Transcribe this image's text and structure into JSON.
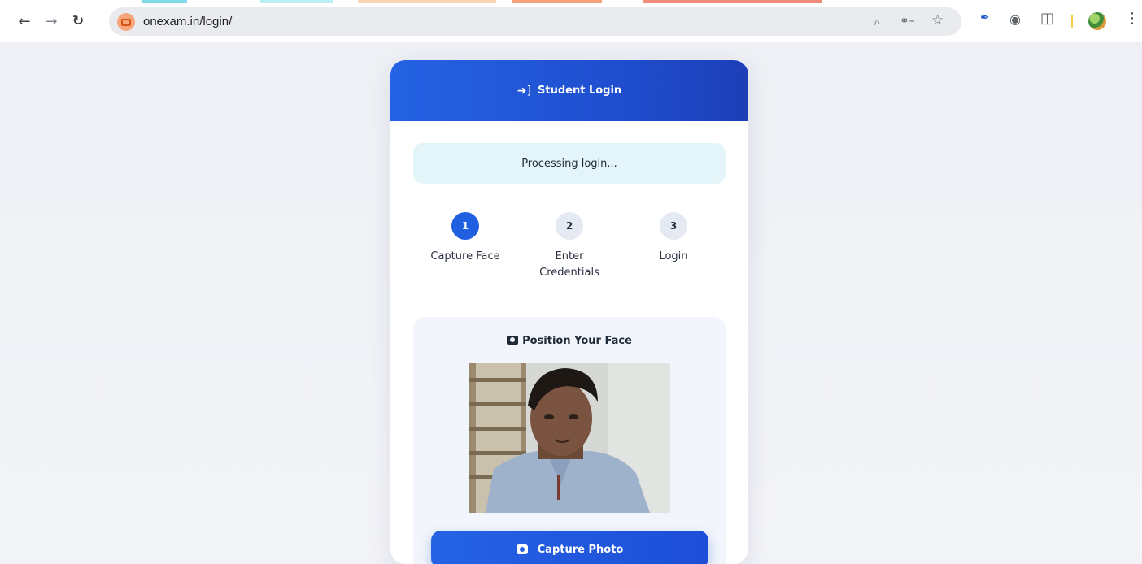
{
  "browser": {
    "url": "onexam.in/login/",
    "nav": {
      "back_icon": "back-arrow-icon",
      "forward_icon": "forward-arrow-icon",
      "reload_icon": "reload-icon"
    },
    "icons": [
      "zoom-icon",
      "password-key-icon",
      "bookmark-star-icon",
      "pen-extension-icon",
      "camera-extension-icon",
      "puzzle-extension-icon",
      "profile-avatar-icon",
      "menu-kebab-icon"
    ]
  },
  "card": {
    "header_title": "Student Login",
    "header_icon": "login-arrow-icon",
    "status_message": "Processing login...",
    "steps": [
      {
        "number": "1",
        "label": "Capture Face",
        "active": true
      },
      {
        "number": "2",
        "label": "Enter Credentials",
        "active": false
      },
      {
        "number": "3",
        "label": "Login",
        "active": false
      }
    ],
    "face_section_title": "Position Your Face",
    "capture_button_label": "Capture Photo"
  },
  "colors": {
    "primary": "#2563e4",
    "status_bg": "#e4f5fa",
    "step_active": "#1f5fe0",
    "step_idle": "#e5e9f2"
  }
}
